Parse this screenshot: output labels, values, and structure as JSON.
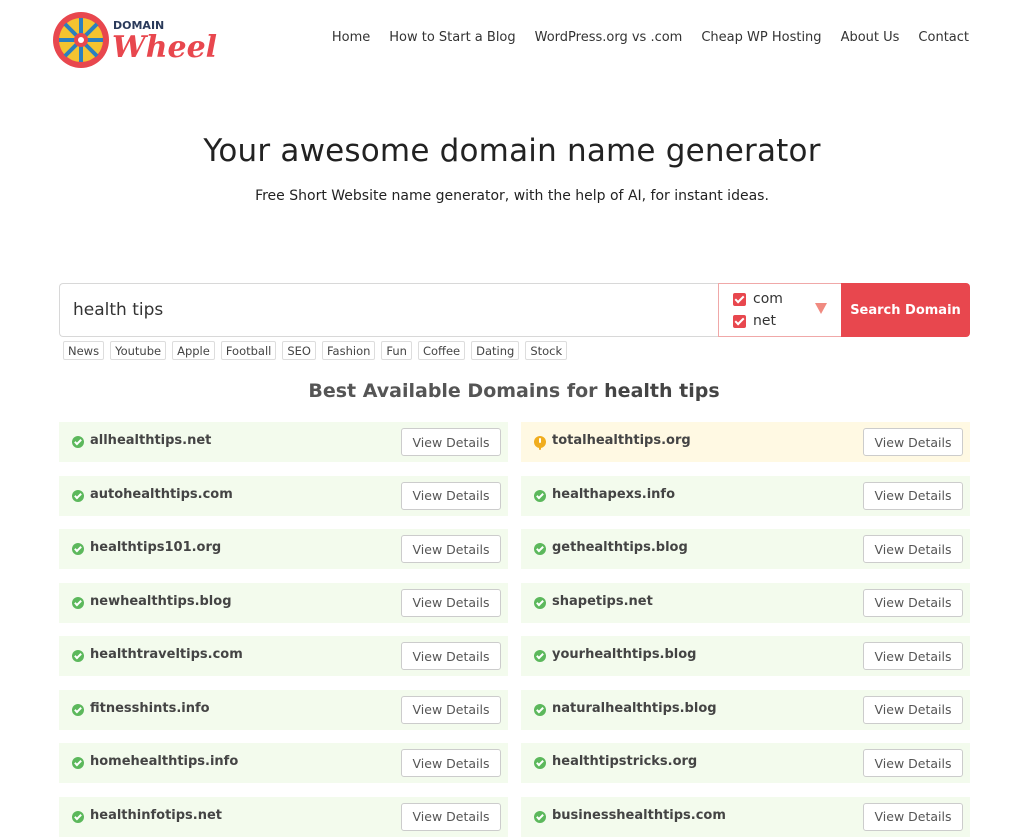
{
  "brand": {
    "logo_top": "DOMAIN",
    "logo_bottom": "Wheel"
  },
  "nav": [
    "Home",
    "How to Start a Blog",
    "WordPress.org vs .com",
    "Cheap WP Hosting",
    "About Us",
    "Contact"
  ],
  "hero": {
    "title": "Your awesome domain name generator",
    "subtitle": "Free Short Website name generator, with the help of AI, for instant ideas."
  },
  "search": {
    "value": "health tips",
    "button": "Search Domain"
  },
  "tlds": [
    {
      "label": "com",
      "checked": true
    },
    {
      "label": "net",
      "checked": true
    }
  ],
  "tags": [
    "News",
    "Youtube",
    "Apple",
    "Football",
    "SEO",
    "Fashion",
    "Fun",
    "Coffee",
    "Dating",
    "Stock"
  ],
  "results": {
    "heading_prefix": "Best Available Domains for",
    "heading_term": "health tips",
    "button_label": "View Details",
    "left": [
      {
        "name": "allhealthtips.net",
        "status": "available"
      },
      {
        "name": "autohealthtips.com",
        "status": "available"
      },
      {
        "name": "healthtips101.org",
        "status": "available"
      },
      {
        "name": "newhealthtips.blog",
        "status": "available"
      },
      {
        "name": "healthtraveltips.com",
        "status": "available"
      },
      {
        "name": "fitnesshints.info",
        "status": "available"
      },
      {
        "name": "homehealthtips.info",
        "status": "available"
      },
      {
        "name": "healthinfotips.net",
        "status": "available"
      }
    ],
    "right": [
      {
        "name": "totalhealthtips.org",
        "status": "warning"
      },
      {
        "name": "healthapexs.info",
        "status": "available"
      },
      {
        "name": "gethealthtips.blog",
        "status": "available"
      },
      {
        "name": "shapetips.net",
        "status": "available"
      },
      {
        "name": "yourhealthtips.blog",
        "status": "available"
      },
      {
        "name": "naturalhealthtips.blog",
        "status": "available"
      },
      {
        "name": "healthtipstricks.org",
        "status": "available"
      },
      {
        "name": "businesshealthtips.com",
        "status": "available"
      }
    ]
  },
  "colors": {
    "accent": "#e8474e",
    "available_bg": "#f3fbed",
    "warning_bg": "#fff9e3"
  }
}
